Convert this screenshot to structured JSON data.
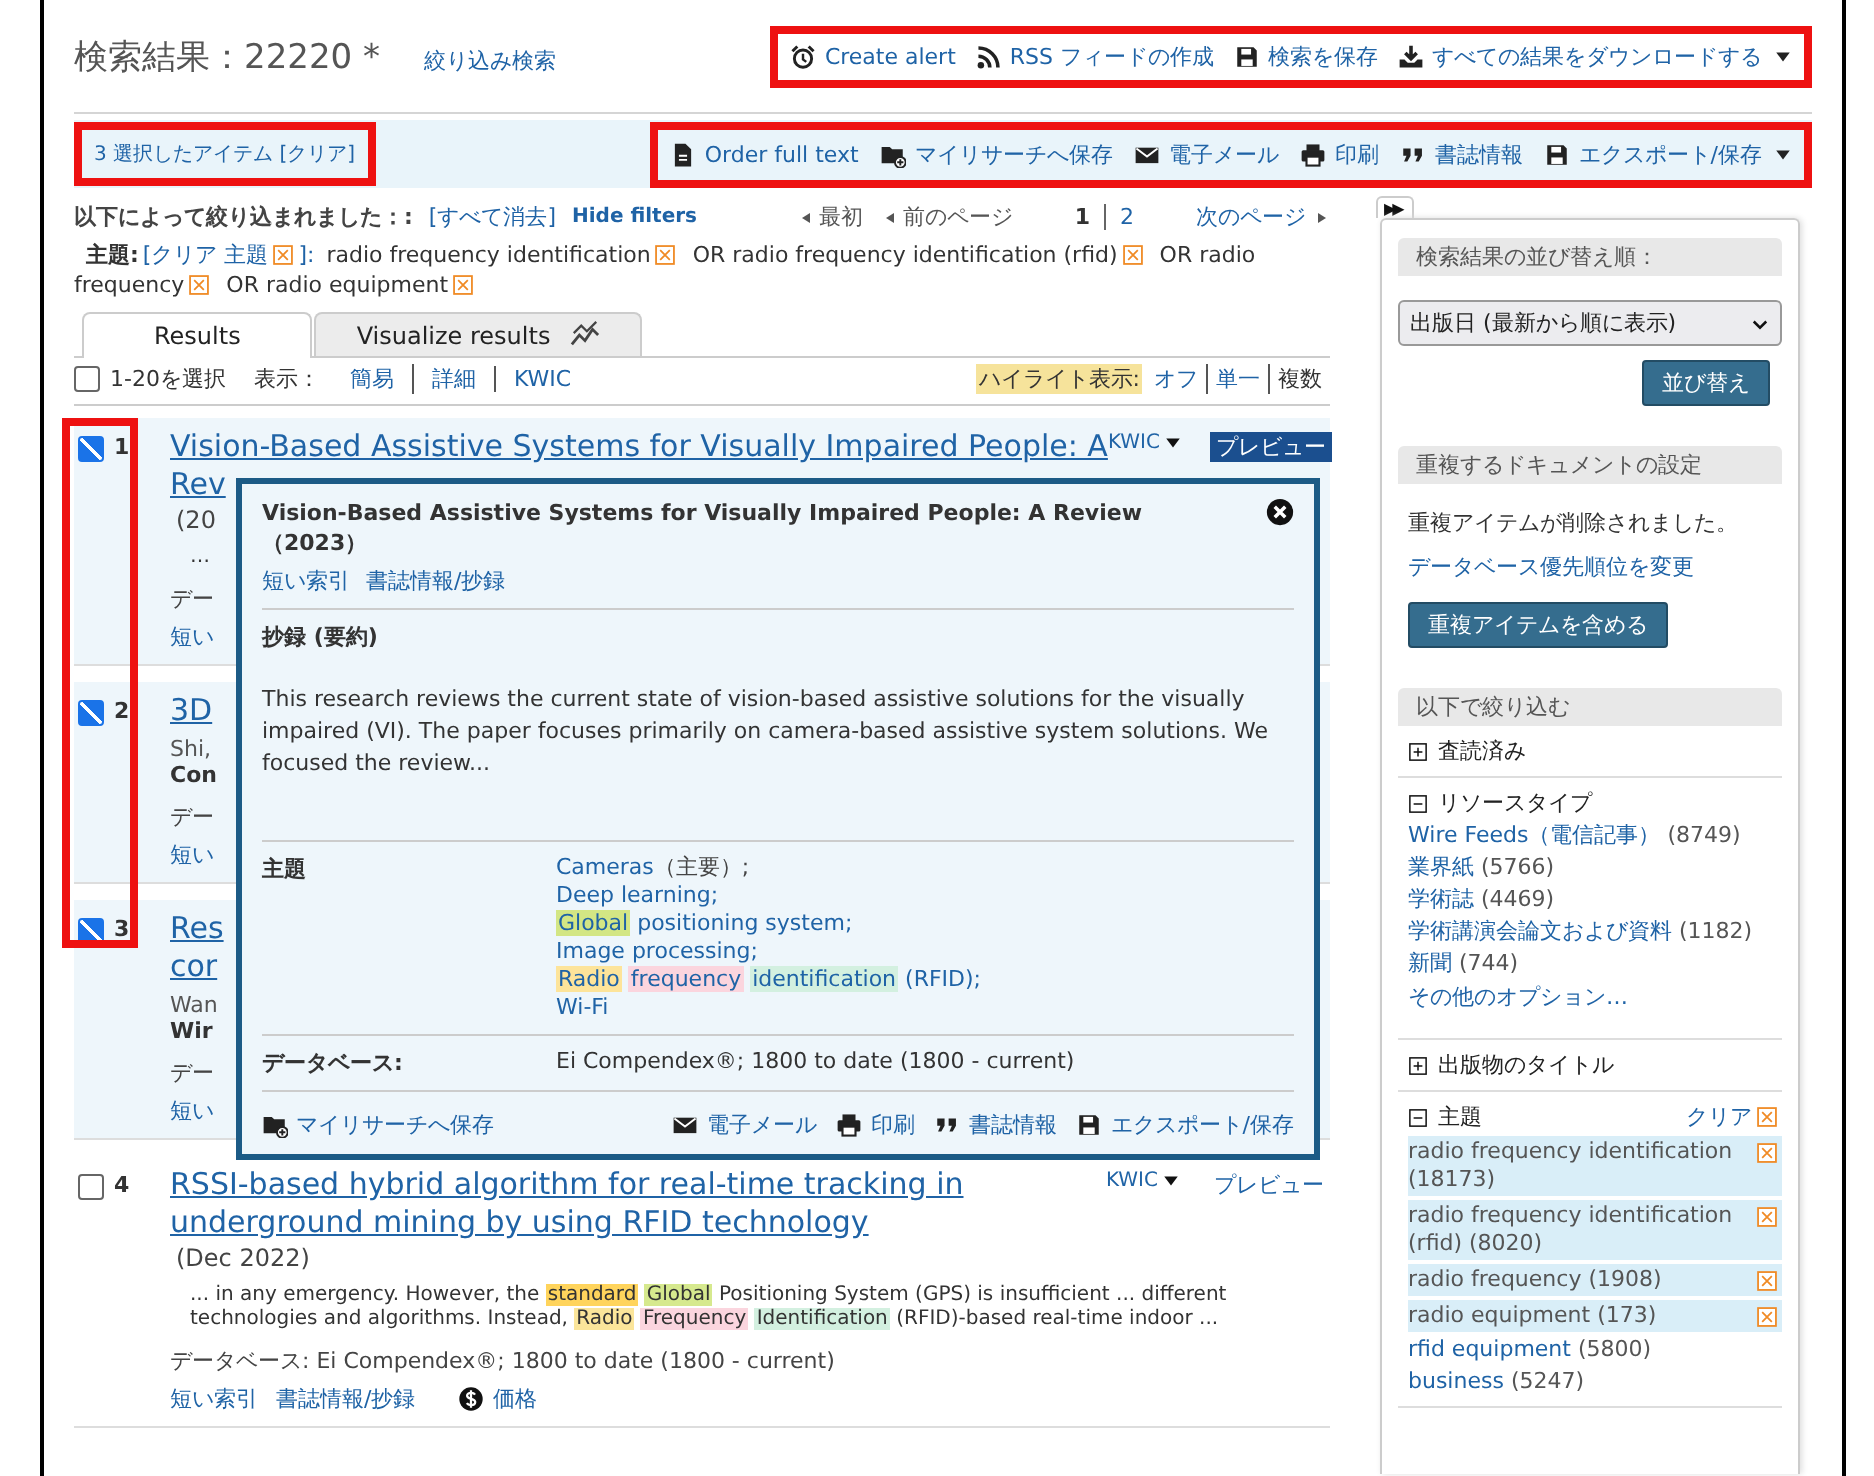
{
  "header": {
    "title": "検索結果：22220 *",
    "refine_link": "絞り込み検索",
    "annotated": true,
    "actions": [
      {
        "kind": "alarm",
        "label": "Create alert",
        "caret": false
      },
      {
        "kind": "rss",
        "label": "RSS フィードの作成",
        "caret": false
      },
      {
        "kind": "save",
        "label": "検索を保存",
        "caret": false
      },
      {
        "kind": "download",
        "label": "すべての結果をダウンロードする",
        "caret": true
      }
    ]
  },
  "selection_bar": {
    "selected_link": "3 選択したアイテム [クリア]",
    "selected_annotated": true,
    "actions_annotated": true,
    "actions": [
      {
        "kind": "document",
        "label": "Order full text",
        "caret": false
      },
      {
        "kind": "folder",
        "label": "マイリサーチへ保存",
        "caret": false
      },
      {
        "kind": "mail",
        "label": "電子メール",
        "caret": false
      },
      {
        "kind": "print",
        "label": "印刷",
        "caret": false
      },
      {
        "kind": "quote",
        "label": "書誌情報",
        "caret": false
      },
      {
        "kind": "save",
        "label": "エクスポート/保存",
        "caret": true
      }
    ]
  },
  "filters": {
    "label": "以下によって絞り込まれました：:",
    "clear_all": "[すべて消去]",
    "hide": "Hide filters",
    "pager": {
      "first": "最初",
      "prev": "前のページ",
      "pages": [
        {
          "label": "1",
          "selected": true
        },
        {
          "label": "2",
          "selected": false
        }
      ],
      "next": "次のページ"
    },
    "subject_label": "主題:",
    "subject_clear": "[クリア 主題",
    "subject_clear_end": "]:",
    "terms": [
      "radio frequency identification",
      "OR radio frequency identification (rfid)",
      "OR radio frequency",
      "OR radio equipment"
    ]
  },
  "tabs": [
    {
      "label": "Results",
      "selected": true
    },
    {
      "label": "Visualize results",
      "selected": false,
      "kind": "chart"
    }
  ],
  "toolbar": {
    "select_all": {
      "label": "1-20を選択",
      "checked": false
    },
    "view_label": "表示：",
    "views": [
      "簡易",
      "詳細",
      "KWIC"
    ],
    "highlight_label": "ハイライト表示:",
    "highlight_options": [
      {
        "label": "オフ",
        "selected": false
      },
      {
        "label": "単一",
        "selected": false
      },
      {
        "label": "複数",
        "selected": true
      }
    ]
  },
  "results": {
    "checkbox_annotation": true,
    "items": [
      {
        "number": "1",
        "checked": true,
        "title_lines": [
          "Vision-Based Assistive Systems for Visually Impaired People: A",
          "Rev"
        ],
        "kwic": "KWIC",
        "preview": "プレビュー",
        "preview_active": true,
        "lines": [
          {
            "kind": "date",
            "text": "(20"
          },
          {
            "kind": "snippet",
            "segments": [
              {
                "text": "…"
              }
            ]
          },
          {
            "kind": "meta",
            "text": "デー"
          },
          {
            "kind": "links",
            "links": [
              {
                "label": "短い"
              }
            ]
          }
        ]
      },
      {
        "number": "2",
        "checked": true,
        "title_lines": [
          "3D"
        ],
        "lines": [
          {
            "kind": "author",
            "text": "Shi,"
          },
          {
            "kind": "source",
            "text": "Con"
          },
          {
            "kind": "meta",
            "text": "デー"
          },
          {
            "kind": "links",
            "links": [
              {
                "label": "短い"
              }
            ]
          }
        ]
      },
      {
        "number": "3",
        "checked": true,
        "title_lines": [
          "Res",
          "cor"
        ],
        "lines": [
          {
            "kind": "author",
            "text": "Wan"
          },
          {
            "kind": "source",
            "text": "Wir"
          },
          {
            "kind": "meta",
            "text": "デー"
          },
          {
            "kind": "links",
            "links": [
              {
                "label": "短い"
              }
            ]
          }
        ]
      },
      {
        "number": "4",
        "checked": false,
        "title_lines": [
          "RSSI-based hybrid algorithm for real-time tracking in",
          "underground mining by using RFID technology"
        ],
        "kwic": "KWIC",
        "preview": "プレビュー",
        "preview_active": false,
        "lines": [
          {
            "kind": "date",
            "text": "(Dec 2022)"
          },
          {
            "kind": "snippet",
            "segments": [
              {
                "text": "... in any emergency. However, the"
              },
              {
                "text": "standard",
                "color": "#ffd45c"
              },
              {
                "text": "Global",
                "color": "#d6e98e"
              },
              {
                "text": "Positioning System (GPS) is insufficient ... different technologies and algorithms. Instead,"
              },
              {
                "text": "Radio",
                "color": "#fbe59a"
              },
              {
                "text": "Frequency",
                "color": "#fbd5de"
              },
              {
                "text": "Identification",
                "color": "#d3f0e0"
              },
              {
                "text": "(RFID)-based real-time indoor ..."
              }
            ]
          },
          {
            "kind": "meta",
            "text": "データベース:  Ei Compendex®; 1800 to date (1800 - current)"
          },
          {
            "kind": "links",
            "links": [
              {
                "label": "短い索引"
              },
              {
                "label": "書誌情報/抄録"
              },
              {
                "label": "価格",
                "kind": "dollar"
              }
            ]
          }
        ]
      }
    ]
  },
  "preview": {
    "title": "Vision-Based Assistive Systems for Visually Impaired People: A Review（2023）",
    "links": [
      "短い索引",
      "書誌情報/抄録"
    ],
    "abstract_heading": "抄録 (要約)",
    "abstract": "This research reviews the current state of vision-based assistive solutions for the visually impaired (VI). The paper focuses primarily on camera-based assistive system solutions. We focused the review...",
    "subject_label": "主題",
    "subject_lines": [
      [
        {
          "text": "Cameras",
          "plain": false
        },
        {
          "text": "（主要）;",
          "plain": true
        }
      ],
      [
        {
          "text": "Deep learning;",
          "plain": false
        }
      ],
      [
        {
          "text": "Global",
          "plain": false,
          "color": "#d3e684"
        },
        {
          "text": "positioning system;",
          "plain": false
        }
      ],
      [
        {
          "text": "Image processing;",
          "plain": false
        }
      ],
      [
        {
          "text": "Radio",
          "plain": false,
          "color": "#fde49a"
        },
        {
          "text": "frequency",
          "plain": false,
          "color": "#fbd5de"
        },
        {
          "text": "identification",
          "plain": false,
          "color": "#d3f0e0"
        },
        {
          "text": "(RFID);",
          "plain": false
        }
      ],
      [
        {
          "text": "Wi-Fi",
          "plain": false
        }
      ]
    ],
    "database_label": "データベース:",
    "database": "Ei Compendex®; 1800 to date (1800 - current)",
    "save": "マイリサーチへ保存",
    "actions": [
      {
        "kind": "mail",
        "label": "電子メール"
      },
      {
        "kind": "print",
        "label": "印刷"
      },
      {
        "kind": "quote",
        "label": "書誌情報"
      },
      {
        "kind": "save",
        "label": "エクスポート/保存"
      }
    ]
  },
  "sidebar": {
    "toggle": "▶▶",
    "sort_heading": "検索結果の並び替え順：",
    "sort_value": "出版日 (最新から順に表示)",
    "sort_button": "並び替え",
    "dup_heading": "重複するドキュメントの設定",
    "dup_text": "重複アイテムが削除されました。",
    "dup_link": "データベース優先順位を変更",
    "dup_button": "重複アイテムを含める",
    "narrow_heading": "以下で絞り込む",
    "facets": [
      {
        "title": "査読済み",
        "expanded": false
      },
      {
        "title": "リソースタイプ",
        "expanded": true,
        "items": [
          {
            "label": "Wire Feeds（電信記事）",
            "count": "(8749)",
            "selected": false
          },
          {
            "label": "業界紙",
            "count": "(5766)",
            "selected": false
          },
          {
            "label": "学術誌",
            "count": "(4469)",
            "selected": false
          },
          {
            "label": "学術講演会論文および資料",
            "count": "(1182)",
            "selected": false
          },
          {
            "label": "新聞",
            "count": "(744)",
            "selected": false
          }
        ],
        "more": "その他のオプション…"
      },
      {
        "title": "出版物のタイトル",
        "expanded": false
      },
      {
        "title": "主題",
        "expanded": true,
        "clear": "クリア",
        "items": [
          {
            "label": "radio frequency identification",
            "count": "(18173)",
            "selected": true
          },
          {
            "label": "radio frequency identification (rfid)",
            "count": "(8020)",
            "selected": true
          },
          {
            "label": "radio frequency",
            "count": "(1908)",
            "selected": true
          },
          {
            "label": "radio equipment",
            "count": "(173)",
            "selected": true
          },
          {
            "label": "rfid equipment",
            "count": "(5800)",
            "selected": false
          },
          {
            "label": "business",
            "count": "(5247)",
            "selected": false
          }
        ]
      }
    ]
  }
}
